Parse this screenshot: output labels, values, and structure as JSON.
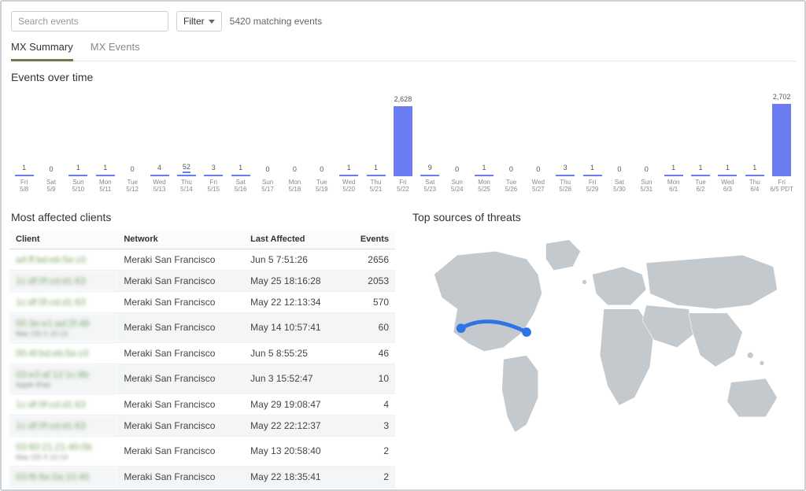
{
  "search": {
    "placeholder": "Search events"
  },
  "filter": {
    "label": "Filter"
  },
  "matching_text": "5420 matching events",
  "tabs": {
    "summary": "MX Summary",
    "events": "MX Events"
  },
  "chart_title": "Events over time",
  "chart_data": {
    "type": "bar",
    "title": "Events over time",
    "xlabel": "",
    "ylabel": "",
    "ylim": [
      0,
      2800
    ],
    "categories": [
      "Fri 5/8",
      "Sat 5/9",
      "Sun 5/10",
      "Mon 5/11",
      "Tue 5/12",
      "Wed 5/13",
      "Thu 5/14",
      "Fri 5/15",
      "Sat 5/16",
      "Sun 5/17",
      "Mon 5/18",
      "Tue 5/19",
      "Wed 5/20",
      "Thu 5/21",
      "Fri 5/22",
      "Sat 5/23",
      "Sun 5/24",
      "Mon 5/25",
      "Tue 5/26",
      "Wed 5/27",
      "Thu 5/28",
      "Fri 5/29",
      "Sat 5/30",
      "Sun 5/31",
      "Mon 6/1",
      "Tue 6/2",
      "Wed 6/3",
      "Thu 6/4",
      "Fri 6/5 PDT"
    ],
    "values": [
      1,
      0,
      1,
      1,
      0,
      4,
      52,
      3,
      1,
      0,
      0,
      0,
      1,
      1,
      2628,
      9,
      0,
      1,
      0,
      0,
      3,
      1,
      0,
      0,
      1,
      1,
      1,
      1,
      2702
    ],
    "highlight_index": 6
  },
  "clients_title": "Most affected clients",
  "clients_headers": {
    "client": "Client",
    "network": "Network",
    "last": "Last Affected",
    "events": "Events"
  },
  "clients_rows": [
    {
      "client": "a4:ff:bd:eb:5e:c0",
      "sub": "",
      "network": "Meraki San Francisco",
      "last": "Jun 5 7:51:26",
      "events": "2656"
    },
    {
      "client": "1c:df:0f:cd:d1:63",
      "sub": "",
      "network": "Meraki San Francisco",
      "last": "May 25 18:16:28",
      "events": "2053"
    },
    {
      "client": "1c:df:0f:cd:d1:63",
      "sub": "",
      "network": "Meraki San Francisco",
      "last": "May 22 12:13:34",
      "events": "570"
    },
    {
      "client": "00:3e:e1:ad:2f:48",
      "sub": "Mac OS X 10.14",
      "network": "Meraki San Francisco",
      "last": "May 14 10:57:41",
      "events": "60"
    },
    {
      "client": "00:4f:bd:eb:5e:c0",
      "sub": "",
      "network": "Meraki San Francisco",
      "last": "Jun 5 8:55:25",
      "events": "46"
    },
    {
      "client": "03:e3:af:12:1c:8b",
      "sub": "Apple iPad",
      "network": "Meraki San Francisco",
      "last": "Jun 3 15:52:47",
      "events": "10"
    },
    {
      "client": "1c:df:0f:cd:d1:63",
      "sub": "",
      "network": "Meraki San Francisco",
      "last": "May 29 19:08:47",
      "events": "4"
    },
    {
      "client": "1c:df:0f:cd:d1:63",
      "sub": "",
      "network": "Meraki San Francisco",
      "last": "May 22 22:12:37",
      "events": "3"
    },
    {
      "client": "03:60:21:21:40:0b",
      "sub": "Mac OS X 10.14",
      "network": "Meraki San Francisco",
      "last": "May 13 20:58:40",
      "events": "2"
    },
    {
      "client": "03:f6:6e:0a:10:40",
      "sub": "",
      "network": "Meraki San Francisco",
      "last": "May 22 18:35:41",
      "events": "2"
    }
  ],
  "threats_title": "Top sources of threats"
}
